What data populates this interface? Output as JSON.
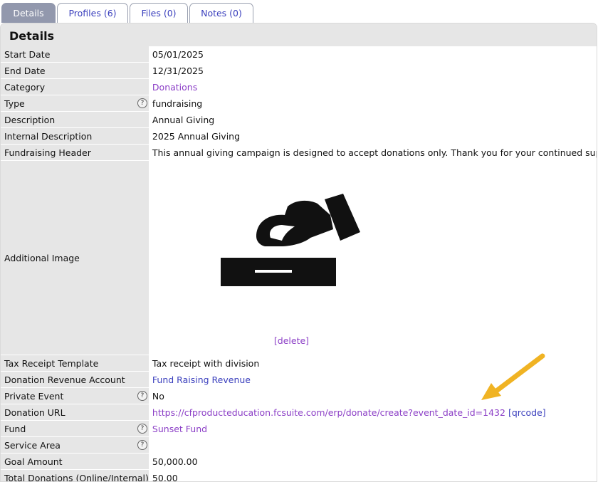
{
  "tabs": [
    {
      "label": "Details",
      "active": true
    },
    {
      "label": "Profiles (6)",
      "active": false
    },
    {
      "label": "Files (0)",
      "active": false
    },
    {
      "label": "Notes (0)",
      "active": false
    }
  ],
  "panel": {
    "title": "Details"
  },
  "rows": {
    "start_date": {
      "label": "Start Date",
      "value": "05/01/2025"
    },
    "end_date": {
      "label": "End Date",
      "value": "12/31/2025"
    },
    "category": {
      "label": "Category",
      "value": "Donations"
    },
    "type": {
      "label": "Type",
      "value": "fundraising"
    },
    "description": {
      "label": "Description",
      "value": "Annual Giving"
    },
    "internal_description": {
      "label": "Internal Description",
      "value": "2025 Annual Giving"
    },
    "fundraising_header": {
      "label": "Fundraising Header",
      "value": "This annual giving campaign is designed to accept donations only. Thank you for your continued support!"
    },
    "additional_image": {
      "label": "Additional Image",
      "delete_label": "[delete]"
    },
    "tax_receipt_template": {
      "label": "Tax Receipt Template",
      "value": "Tax receipt with division"
    },
    "donation_revenue_account": {
      "label": "Donation Revenue Account",
      "value": "Fund Raising Revenue"
    },
    "private_event": {
      "label": "Private Event",
      "value": "No"
    },
    "donation_url": {
      "label": "Donation URL",
      "value": "https://cfproducteducation.fcsuite.com/erp/donate/create?event_date_id=1432",
      "qrcode_label": "[qrcode]"
    },
    "fund": {
      "label": "Fund",
      "value": "Sunset Fund"
    },
    "service_area": {
      "label": "Service Area",
      "value": ""
    },
    "goal_amount": {
      "label": "Goal Amount",
      "value": "50,000.00"
    },
    "total_donations": {
      "label": "Total Donations (Online/Internal)",
      "value": "50.00"
    }
  },
  "help_glyph": "?",
  "colors": {
    "tab_active_bg": "#9298ad",
    "link_blue": "#3a3fbd",
    "link_purple": "#8b3ec6",
    "label_bg": "#e6e6e6",
    "arrow": "#f0b323"
  },
  "icons": {
    "image": "donation-hand-box-icon",
    "help": "help-circle-icon",
    "annotation": "arrow-icon"
  }
}
